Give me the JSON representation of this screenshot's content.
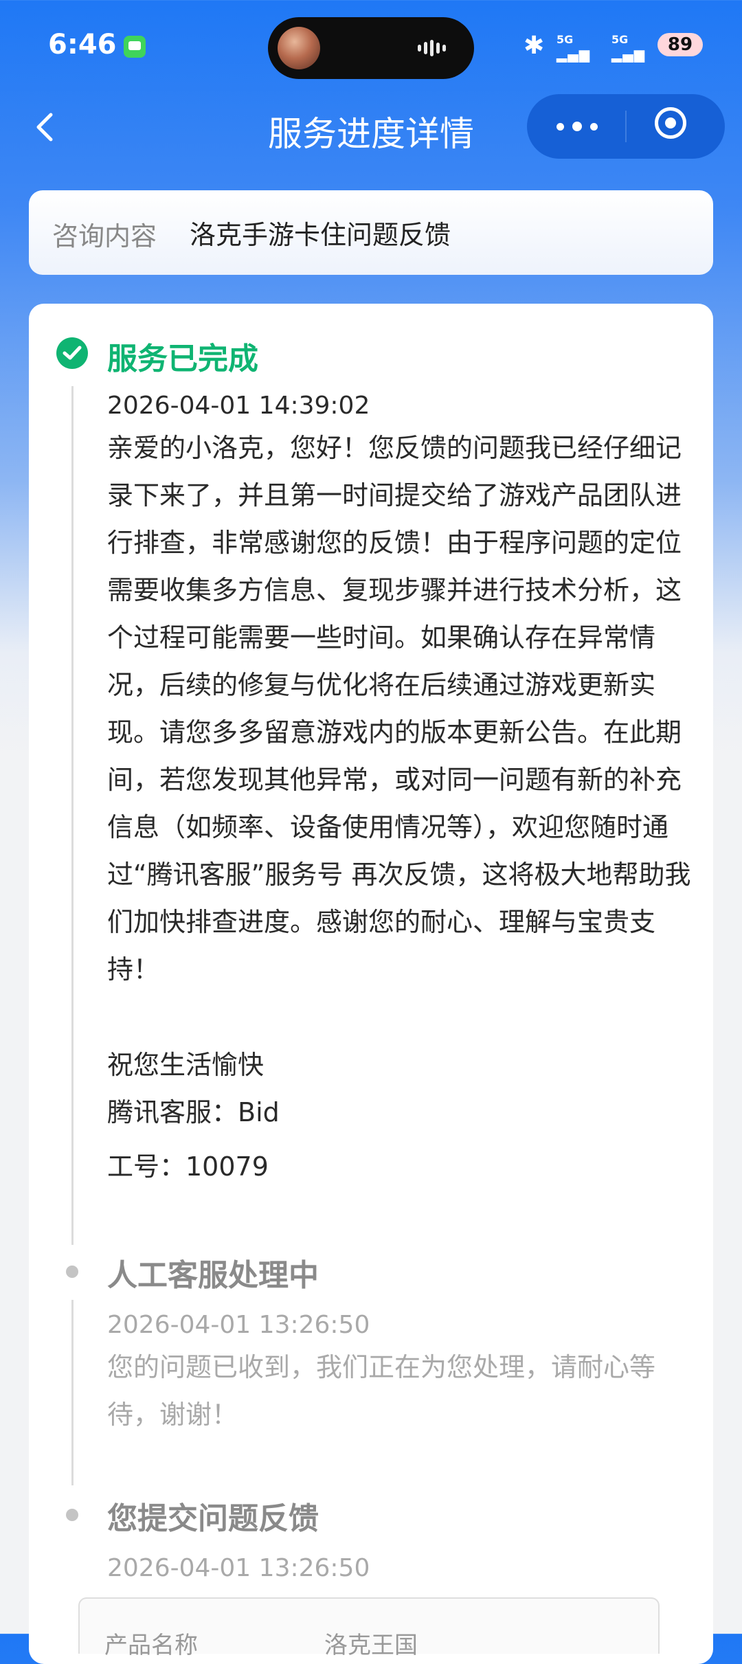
{
  "status_bar": {
    "time": "6:46",
    "signal_1": "5G",
    "signal_2": "5G",
    "battery": "89"
  },
  "nav": {
    "title": "服务进度详情"
  },
  "consult": {
    "label": "咨询内容",
    "value": "洛克手游卡住问题反馈"
  },
  "steps": [
    {
      "title": "服务已完成",
      "time": "2026-04-01 14:39:02",
      "paragraph": "亲爱的小洛克，您好！您反馈的问题我已经仔细记录下来了，并且第一时间提交给了游戏产品团队进行排查，非常感谢您的反馈！由于程序问题的定位需要收集多方信息、复现步骤并进行技术分析，这个过程可能需要一些时间。如果确认存在异常情况，后续的修复与优化将在后续通过游戏更新实现。请您多多留意游戏内的版本更新公告。在此期间，若您发现其他异常，或对同一问题有新的补充信息（如频率、设备使用情况等），欢迎您随时通过“腾讯客服”服务号 再次反馈，这将极大地帮助我们加快排查进度。感谢您的耐心、理解与宝贵支持！",
      "closing": "祝您生活愉快",
      "agent": "腾讯客服：Bid",
      "staff_id": "工号：10079"
    },
    {
      "title": "人工客服处理中",
      "time": "2026-04-01 13:26:50",
      "text": "您的问题已收到，我们正在为您处理，请耐心等待，谢谢！"
    },
    {
      "title": "您提交问题反馈",
      "time": "2026-04-01 13:26:50",
      "detail_label": "产品名称",
      "detail_value": "洛克王国"
    }
  ],
  "colors": {
    "accent_blue": "#1f78f5",
    "done_green": "#0fb472",
    "muted_gray": "#a9a9a9"
  }
}
